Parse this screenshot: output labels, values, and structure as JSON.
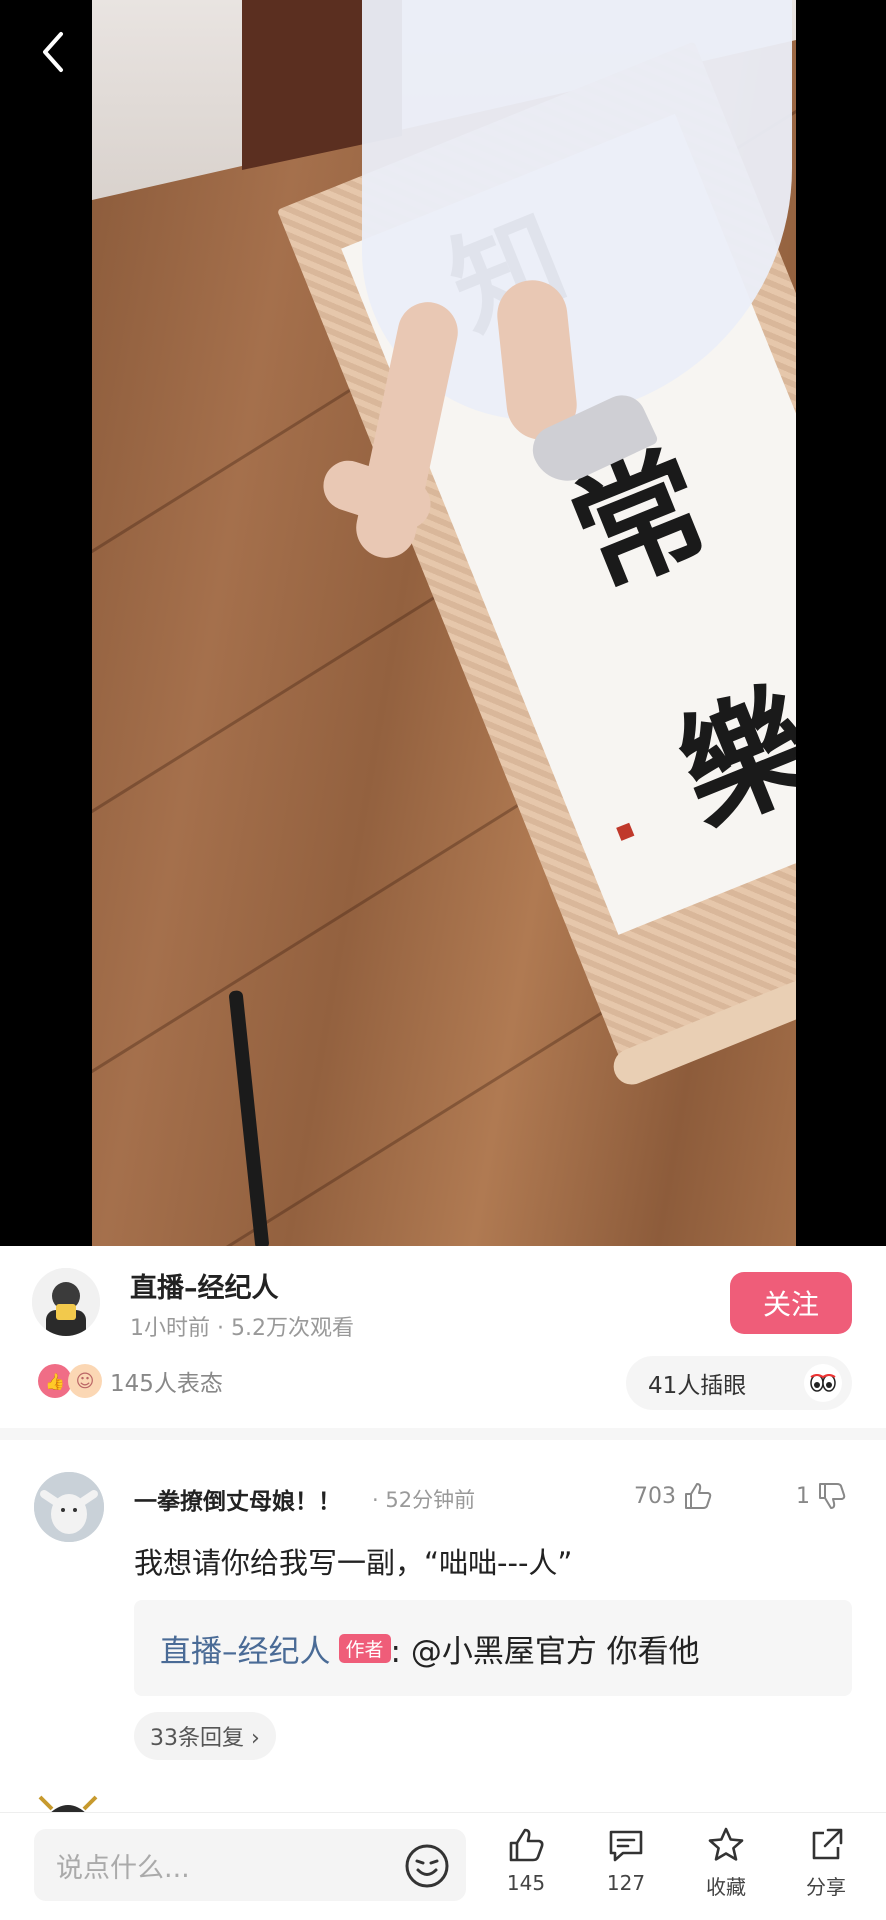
{
  "video": {
    "calligraphy": [
      "知",
      "常",
      "樂"
    ]
  },
  "author": {
    "name": "直播–经纪人",
    "meta": "1小时前 · 5.2万次观看",
    "follow_label": "关注",
    "reactions_text": "145人表态",
    "eye_text": "41人插眼"
  },
  "comment": {
    "user": "一拳撩倒丈母娘！！",
    "time": "· 52分钟前",
    "likes": "703",
    "dislikes": "1",
    "text": "我想请你给我写一副，“咄咄---人”",
    "reply": {
      "author": "直播–经纪人",
      "tag": "作者",
      "text": ": @小黑屋官方 你看他"
    },
    "more_replies": "33条回复 ›"
  },
  "bottom_bar": {
    "input_placeholder": "说点什么...",
    "like_count": "145",
    "comment_count": "127",
    "favorite_label": "收藏",
    "share_label": "分享"
  },
  "colors": {
    "accent": "#ef5d79",
    "reply_author": "#4a6b96"
  }
}
